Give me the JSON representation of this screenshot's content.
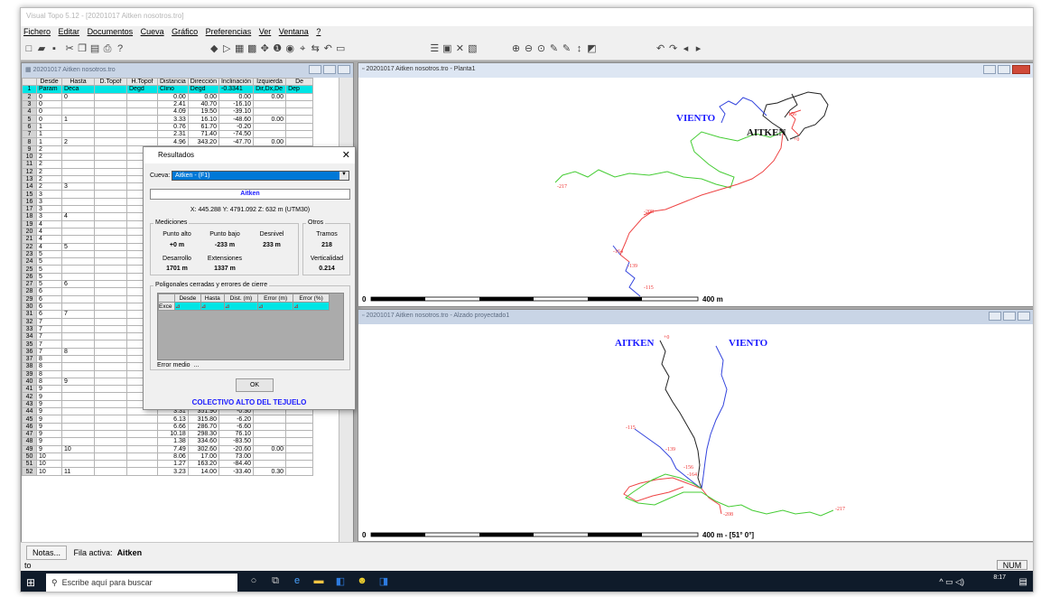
{
  "window": {
    "title": "Visual Topo 5.12 - [20201017 Aitken nosotros.tro]"
  },
  "menu": [
    "Fichero",
    "Editar",
    "Documentos",
    "Cueva",
    "Gráfico",
    "Preferencias",
    "Ver",
    "Ventana",
    "?"
  ],
  "table_window": {
    "title": "20201017 Aitken nosotros.tro",
    "headers": [
      "",
      "Desde",
      "Hasta",
      "D.Topof",
      "H.Topof",
      "Distancia",
      "Dirección",
      "Inclinación",
      "Izquierda",
      "De"
    ],
    "units_row": [
      "1",
      "Param",
      "Deca",
      "",
      "Degd",
      "Clino",
      "Degd",
      "-0.3341",
      "Dir,Dx,De",
      "Dep"
    ],
    "rows": [
      [
        "2",
        "0",
        "0",
        "",
        "",
        "0.00",
        "0.00",
        "0.00",
        "0.00"
      ],
      [
        "3",
        "0",
        "",
        "",
        "",
        "2.41",
        "40.70",
        "-16.10",
        ""
      ],
      [
        "4",
        "0",
        "",
        "",
        "",
        "4.09",
        "19.50",
        "-39.10",
        ""
      ],
      [
        "5",
        "0",
        "1",
        "",
        "",
        "3.33",
        "16.10",
        "-48.60",
        "0.00"
      ],
      [
        "6",
        "1",
        "",
        "",
        "",
        "0.76",
        "61.70",
        "-0.20",
        ""
      ],
      [
        "7",
        "1",
        "",
        "",
        "",
        "2.31",
        "71.40",
        "-74.50",
        ""
      ],
      [
        "8",
        "1",
        "2",
        "",
        "",
        "4.96",
        "343.20",
        "-47.70",
        "0.00"
      ],
      [
        "9",
        "2",
        "",
        "",
        "",
        "",
        "",
        "",
        ""
      ],
      [
        "10",
        "2",
        "",
        "",
        "",
        "",
        "",
        "",
        ""
      ],
      [
        "11",
        "2",
        "",
        "",
        "",
        "",
        "",
        "",
        ""
      ],
      [
        "12",
        "2",
        "",
        "",
        "",
        "",
        "",
        "",
        ""
      ],
      [
        "13",
        "2",
        "",
        "",
        "",
        "",
        "",
        "",
        ""
      ],
      [
        "14",
        "2",
        "3",
        "",
        "",
        "",
        "",
        "",
        ""
      ],
      [
        "15",
        "3",
        "",
        "",
        "",
        "",
        "",
        "",
        ""
      ],
      [
        "16",
        "3",
        "",
        "",
        "",
        "",
        "",
        "",
        ""
      ],
      [
        "17",
        "3",
        "",
        "",
        "",
        "",
        "",
        "",
        ""
      ],
      [
        "18",
        "3",
        "4",
        "",
        "",
        "",
        "",
        "",
        ""
      ],
      [
        "19",
        "4",
        "",
        "",
        "",
        "",
        "",
        "",
        ""
      ],
      [
        "20",
        "4",
        "",
        "",
        "",
        "",
        "",
        "",
        ""
      ],
      [
        "21",
        "4",
        "",
        "",
        "",
        "",
        "",
        "",
        ""
      ],
      [
        "22",
        "4",
        "5",
        "",
        "",
        "",
        "",
        "",
        ""
      ],
      [
        "23",
        "5",
        "",
        "",
        "",
        "",
        "",
        "",
        ""
      ],
      [
        "24",
        "5",
        "",
        "",
        "",
        "",
        "",
        "",
        ""
      ],
      [
        "25",
        "5",
        "",
        "",
        "",
        "",
        "",
        "",
        ""
      ],
      [
        "26",
        "5",
        "",
        "",
        "",
        "",
        "",
        "",
        ""
      ],
      [
        "27",
        "5",
        "6",
        "",
        "",
        "",
        "",
        "",
        ""
      ],
      [
        "28",
        "6",
        "",
        "",
        "",
        "",
        "",
        "",
        ""
      ],
      [
        "29",
        "6",
        "",
        "",
        "",
        "",
        "",
        "",
        ""
      ],
      [
        "30",
        "6",
        "",
        "",
        "",
        "",
        "",
        "",
        ""
      ],
      [
        "31",
        "6",
        "7",
        "",
        "",
        "",
        "",
        "",
        ""
      ],
      [
        "32",
        "7",
        "",
        "",
        "",
        "",
        "",
        "",
        ""
      ],
      [
        "33",
        "7",
        "",
        "",
        "",
        "",
        "",
        "",
        ""
      ],
      [
        "34",
        "7",
        "",
        "",
        "",
        "",
        "",
        "",
        ""
      ],
      [
        "35",
        "7",
        "",
        "",
        "",
        "",
        "",
        "",
        ""
      ],
      [
        "36",
        "7",
        "8",
        "",
        "",
        "",
        "",
        "",
        ""
      ],
      [
        "37",
        "8",
        "",
        "",
        "",
        "",
        "",
        "",
        ""
      ],
      [
        "38",
        "8",
        "",
        "",
        "",
        "",
        "",
        "",
        ""
      ],
      [
        "39",
        "8",
        "",
        "",
        "",
        "1.21",
        "79.50",
        "-85.50",
        ""
      ],
      [
        "40",
        "8",
        "9",
        "",
        "",
        "2.95",
        "62.90",
        "-33.00",
        "5.83"
      ],
      [
        "41",
        "9",
        "",
        "",
        "",
        "1.67",
        "268.00",
        "3.30",
        ""
      ],
      [
        "42",
        "9",
        "",
        "",
        "",
        "2.49",
        "79.50",
        "1.40",
        ""
      ],
      [
        "43",
        "9",
        "",
        "",
        "",
        "3.83",
        "31.30",
        "4.70",
        ""
      ],
      [
        "44",
        "9",
        "",
        "",
        "",
        "3.31",
        "351.90",
        "-0.30",
        ""
      ],
      [
        "45",
        "9",
        "",
        "",
        "",
        "6.13",
        "315.80",
        "-6.20",
        ""
      ],
      [
        "46",
        "9",
        "",
        "",
        "",
        "6.66",
        "286.70",
        "-6.60",
        ""
      ],
      [
        "47",
        "9",
        "",
        "",
        "",
        "10.18",
        "298.30",
        "76.10",
        ""
      ],
      [
        "48",
        "9",
        "",
        "",
        "",
        "1.38",
        "334.60",
        "-83.50",
        ""
      ],
      [
        "49",
        "9",
        "10",
        "",
        "",
        "7.49",
        "302.60",
        "-20.60",
        "0.00"
      ],
      [
        "50",
        "10",
        "",
        "",
        "",
        "8.06",
        "17.00",
        "73.00",
        ""
      ],
      [
        "51",
        "10",
        "",
        "",
        "",
        "1.27",
        "163.20",
        "-84.40",
        ""
      ],
      [
        "52",
        "10",
        "11",
        "",
        "",
        "3.23",
        "14.00",
        "-33.40",
        "0.30"
      ]
    ]
  },
  "dialog": {
    "title": "Resultados",
    "cueva_label": "Cueva:",
    "cueva_value": "Aitken - (F1)",
    "cave_name": "Aitken",
    "coords": "X: 445.288 Y: 4791.092 Z: 632 m (UTM30)",
    "mediciones_label": "Mediciones",
    "otros_label": "Otros",
    "punto_alto_label": "Punto alto",
    "punto_alto_value": "+0 m",
    "punto_bajo_label": "Punto bajo",
    "punto_bajo_value": "-233 m",
    "desnivel_label": "Desnivel",
    "desnivel_value": "233 m",
    "tramos_label": "Tramos",
    "tramos_value": "218",
    "desarrollo_label": "Desarrollo",
    "desarrollo_value": "1701 m",
    "extensiones_label": "Extensiones",
    "extensiones_value": "1337 m",
    "verticalidad_label": "Verticalidad",
    "verticalidad_value": "0.214",
    "poligonales_label": "Poligonales cerradas y errores de cierre",
    "pgrid_headers": [
      "",
      "Desde",
      "Hasta",
      "Dist. (m)",
      "Error (m)",
      "Error (%)"
    ],
    "pgrid_row_label": "Exce",
    "error_medio_label": "Error medio",
    "error_medio_value": "...",
    "ok_label": "OK",
    "footer": "COLECTIVO ALTO DEL TEJUELO"
  },
  "plan_window": {
    "title": "20201017 Aitken nosotros.tro - Planta1",
    "labels": {
      "viento": "VIENTO",
      "aitken": "AITKEN",
      "d0": "+0",
      "d217": "-217",
      "d208": "-208",
      "d164": "-164",
      "d139": "-139",
      "d115": "-115",
      "d156": "-156"
    },
    "scale_zero": "0",
    "scale_text": "400 m"
  },
  "profile_window": {
    "title": "20201017 Aitken nosotros.tro - Alzado proyectado1",
    "labels": {
      "aitken": "AITKEN",
      "viento": "VIENTO",
      "d0": "+0",
      "d115": "-115",
      "d139": "-139",
      "d156": "-156",
      "d164": "-164",
      "d208": "-208",
      "d217": "-217"
    },
    "scale_zero": "0",
    "scale_text": "400 m - [51° 0°]"
  },
  "statusbar": {
    "notas": "Notas...",
    "fila_label": "Fila activa:",
    "fila_value": "Aitken",
    "num": "NUM",
    "left_text": "to"
  },
  "taskbar": {
    "search_placeholder": "Escribe aquí para buscar",
    "time": "8:17"
  },
  "colors": {
    "cyan": "#00e5e5",
    "accent_blue": "#1a1aff",
    "title_inactive": "#c9d5e6",
    "taskbar": "#0f1b2a"
  }
}
